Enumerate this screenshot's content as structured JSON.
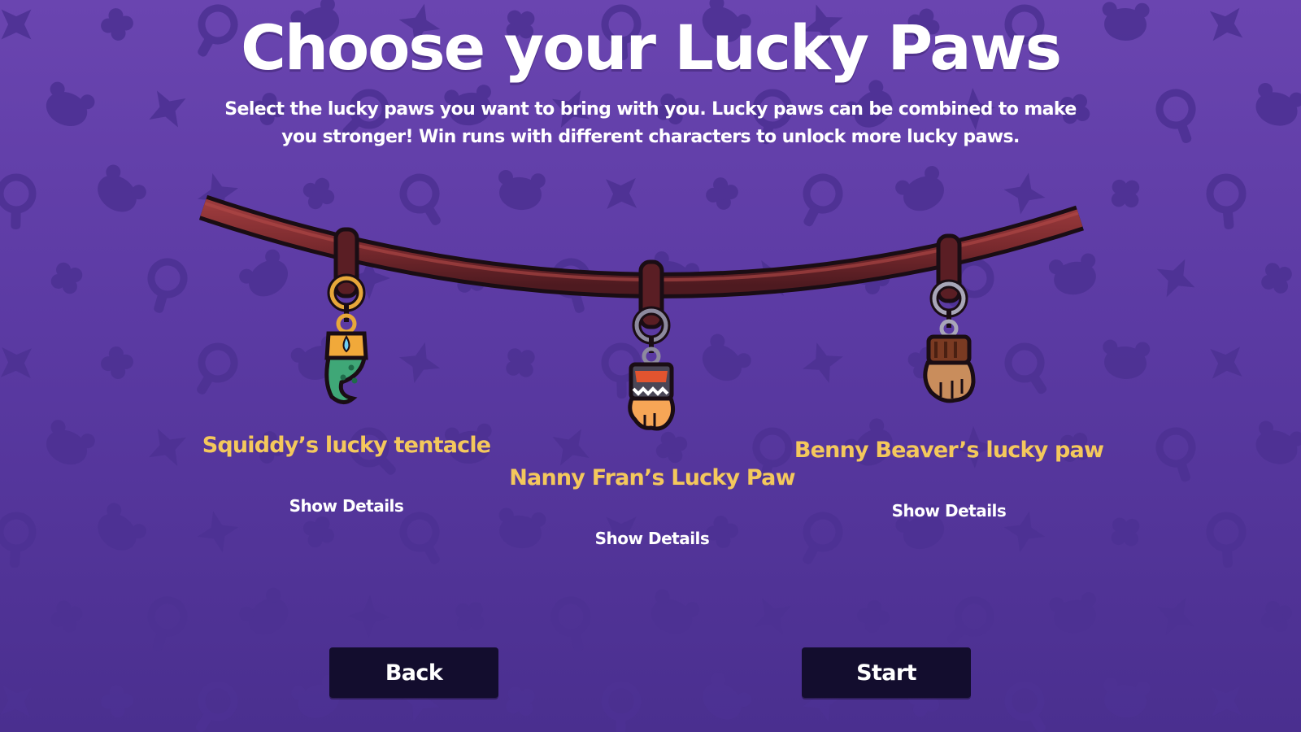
{
  "header": {
    "title": "Choose your Lucky Paws",
    "description": "Select the lucky paws you want to bring with you. Lucky paws can be combined to make you stronger! Win runs with different characters to unlock more lucky paws."
  },
  "paws": [
    {
      "name": "Squiddy’s lucky tentacle",
      "details_label": "Show Details",
      "icon": "tentacle-charm-icon"
    },
    {
      "name": "Nanny Fran’s Lucky Paw",
      "details_label": "Show Details",
      "icon": "fran-paw-charm-icon"
    },
    {
      "name": "Benny Beaver’s lucky paw",
      "details_label": "Show Details",
      "icon": "beaver-paw-charm-icon"
    }
  ],
  "buttons": {
    "back": "Back",
    "start": "Start"
  },
  "colors": {
    "background": "#5b3aa3",
    "pattern": "#4d3293",
    "paw_name": "#f4c85c",
    "button_bg": "#130d2e",
    "strap": "#7a2a2e"
  }
}
